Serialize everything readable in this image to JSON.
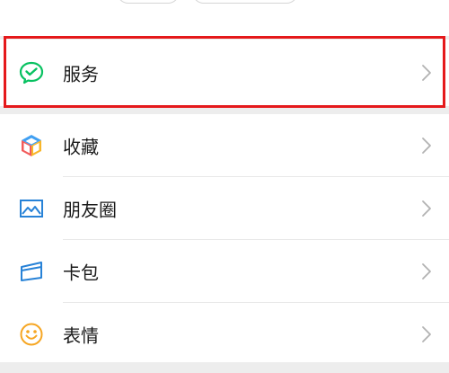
{
  "menu": {
    "services": {
      "label": "服务",
      "icon": "wechat-pay-icon",
      "color": "#07c160"
    },
    "items": [
      {
        "key": "favorites",
        "label": "收藏",
        "icon": "cube-icon"
      },
      {
        "key": "moments",
        "label": "朋友圈",
        "icon": "photo-icon",
        "color": "#2782d7"
      },
      {
        "key": "cards",
        "label": "卡包",
        "icon": "card-wallet-icon",
        "color": "#2782d7"
      },
      {
        "key": "stickers",
        "label": "表情",
        "icon": "smiley-icon",
        "color": "#f6a623"
      }
    ]
  },
  "highlight_color": "#e5191b"
}
